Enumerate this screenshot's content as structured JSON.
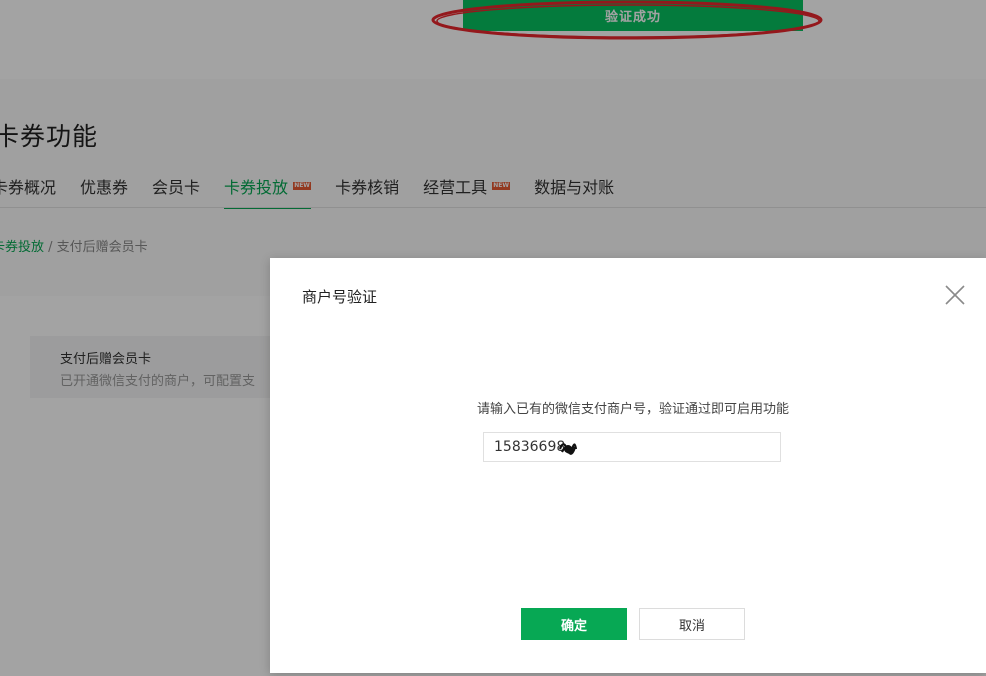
{
  "toast": {
    "message": "验证成功"
  },
  "annotation": {
    "color": "#e8262c"
  },
  "page": {
    "title": "卡券功能",
    "tabs": [
      {
        "label": "卡券概况"
      },
      {
        "label": "优惠券"
      },
      {
        "label": "会员卡"
      },
      {
        "label": "卡券投放",
        "badge": "NEW",
        "active": true
      },
      {
        "label": "卡券核销"
      },
      {
        "label": "经营工具",
        "badge": "NEW"
      },
      {
        "label": "数据与对账"
      }
    ],
    "breadcrumb": {
      "parent": "卡券投放",
      "separator": " / ",
      "current": "支付后赠会员卡"
    },
    "feature_card": {
      "title": "支付后赠会员卡",
      "description": "已开通微信支付的商户，可配置支"
    }
  },
  "modal": {
    "title": "商户号验证",
    "hint": "请输入已有的微信支付商户号，验证通过即可启用功能",
    "merchant_id_value": "15836698",
    "confirm_label": "确定",
    "cancel_label": "取消"
  },
  "colors": {
    "brand_green": "#07a854",
    "toast_green": "#07c160",
    "new_badge": "#e75a33"
  }
}
